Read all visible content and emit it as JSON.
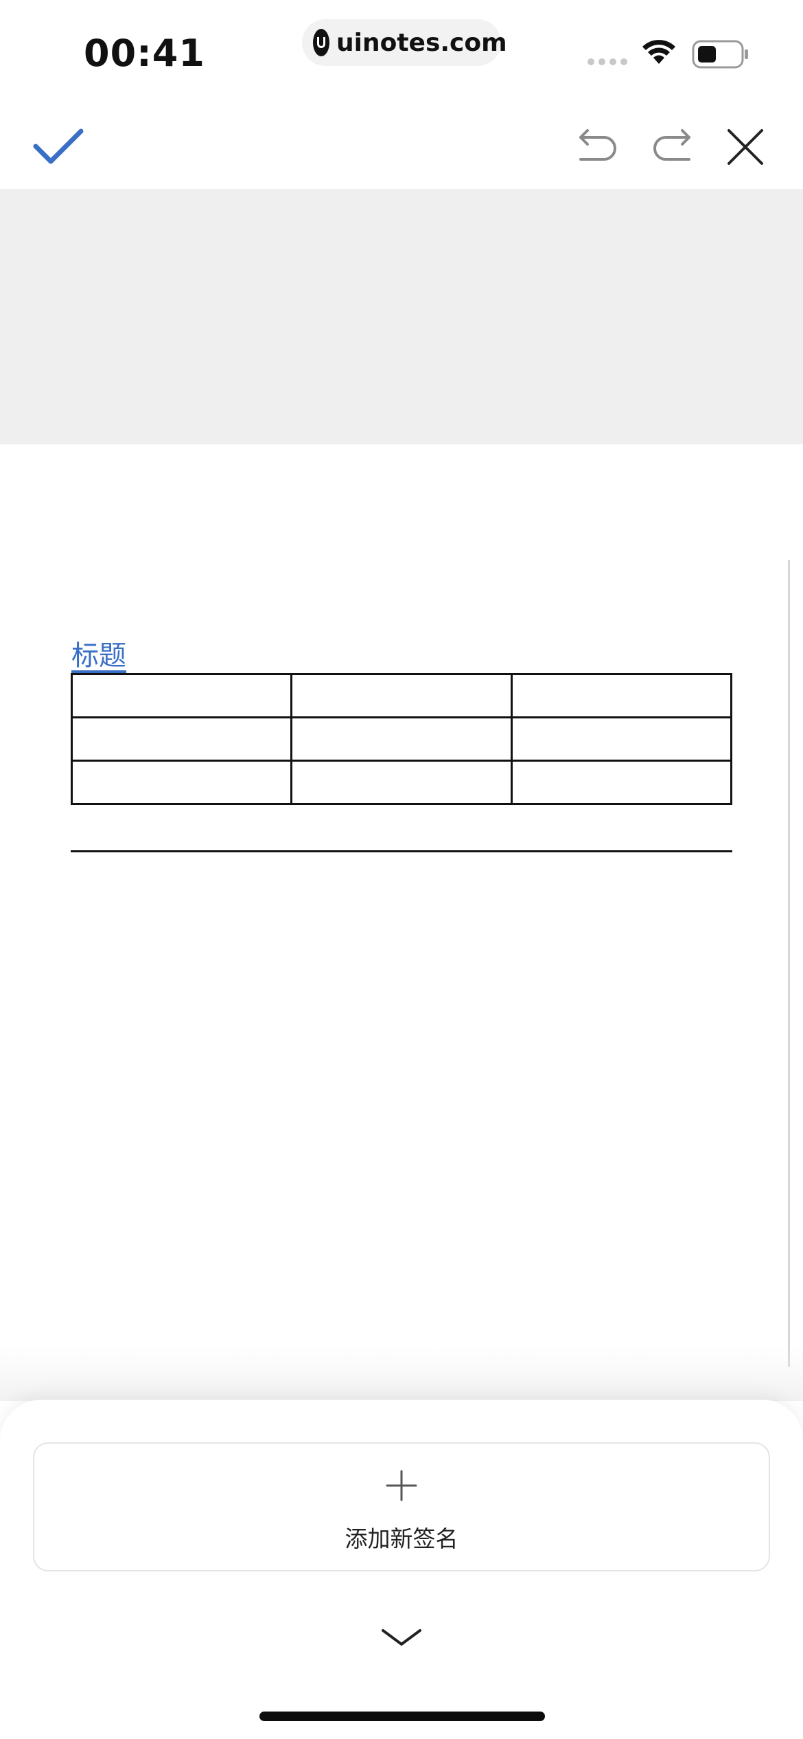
{
  "status_bar": {
    "time": "00:41",
    "url": "uinotes.com",
    "icons": [
      "signal-icon",
      "wifi-icon",
      "battery-icon"
    ]
  },
  "toolbar": {
    "confirm_icon": "checkmark-icon",
    "undo_icon": "undo-icon",
    "redo_icon": "redo-icon",
    "close_icon": "close-icon",
    "accent_color": "#3a6fc6"
  },
  "document": {
    "title": "标题",
    "table": {
      "rows": 3,
      "columns": 3,
      "cells": [
        [
          "",
          "",
          ""
        ],
        [
          "",
          "",
          ""
        ],
        [
          "",
          "",
          ""
        ]
      ]
    }
  },
  "bottom_sheet": {
    "add_signature_label": "添加新签名",
    "add_icon": "plus-icon",
    "collapse_icon": "chevron-down-icon"
  }
}
